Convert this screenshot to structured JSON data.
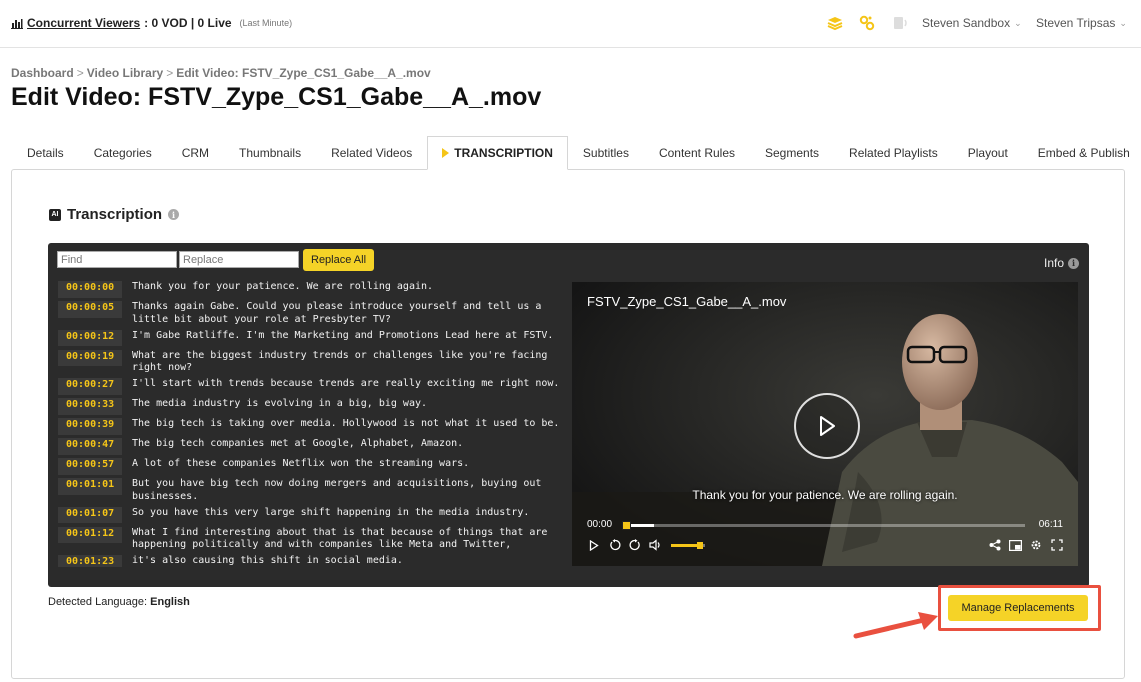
{
  "topbar": {
    "viewers_label": "Concurrent Viewers",
    "viewers_value": ": 0 VOD | 0 Live",
    "viewers_note": "(Last Minute)",
    "user_sandbox": "Steven Sandbox",
    "user_name": "Steven Tripsas"
  },
  "breadcrumb": {
    "items": [
      "Dashboard",
      "Video Library",
      "Edit Video: FSTV_Zype_CS1_Gabe__A_.mov"
    ],
    "separator": ">"
  },
  "page_title": "Edit Video: FSTV_Zype_CS1_Gabe__A_.mov",
  "tabs": [
    "Details",
    "Categories",
    "CRM",
    "Thumbnails",
    "Related Videos",
    "Transcription",
    "Subtitles",
    "Content Rules",
    "Segments",
    "Related Playlists",
    "Playout",
    "Embed & Publish"
  ],
  "active_tab": "Transcription",
  "section": {
    "title": "Transcription",
    "ai_badge": "AI",
    "info_glyph": "i"
  },
  "toolbar": {
    "find_placeholder": "Find",
    "replace_placeholder": "Replace",
    "replace_all": "Replace All",
    "info_label": "Info"
  },
  "transcript": [
    {
      "time": "00:00:00",
      "text": "Thank you for your patience. We are rolling again."
    },
    {
      "time": "00:00:05",
      "text": "Thanks again Gabe. Could you please introduce yourself and tell us a little bit about your role at Presbyter TV?"
    },
    {
      "time": "00:00:12",
      "text": "I'm Gabe Ratliffe. I'm the Marketing and Promotions Lead here at FSTV."
    },
    {
      "time": "00:00:19",
      "text": "What are the biggest industry trends or challenges like you're facing right now?"
    },
    {
      "time": "00:00:27",
      "text": "I'll start with trends because trends are really exciting me right now."
    },
    {
      "time": "00:00:33",
      "text": "The media industry is evolving in a big, big way."
    },
    {
      "time": "00:00:39",
      "text": "The big tech is taking over media. Hollywood is not what it used to be."
    },
    {
      "time": "00:00:47",
      "text": "The big tech companies met at Google, Alphabet, Amazon."
    },
    {
      "time": "00:00:57",
      "text": "A lot of these companies Netflix won the streaming wars."
    },
    {
      "time": "00:01:01",
      "text": "But you have big tech now doing mergers and acquisitions, buying out businesses."
    },
    {
      "time": "00:01:07",
      "text": "So you have this very large shift happening in the media industry."
    },
    {
      "time": "00:01:12",
      "text": "What I find interesting about that is that because of things that are happening politically and with companies like Meta and Twitter,"
    },
    {
      "time": "00:01:23",
      "text": "it's also causing this shift in social media."
    }
  ],
  "player": {
    "title": "FSTV_Zype_CS1_Gabe__A_.mov",
    "caption": "Thank you for your patience. We are rolling again.",
    "current_time": "00:00",
    "duration": "06:11",
    "progress_fraction": 0.08,
    "volume_fraction": 0.85
  },
  "detected_language": {
    "label": "Detected Language:",
    "value": "English"
  },
  "manage_button": "Manage Replacements",
  "colors": {
    "accent_yellow": "#f5d327",
    "highlight_red": "#e9503f",
    "dark_panel": "#2b2b2b"
  }
}
